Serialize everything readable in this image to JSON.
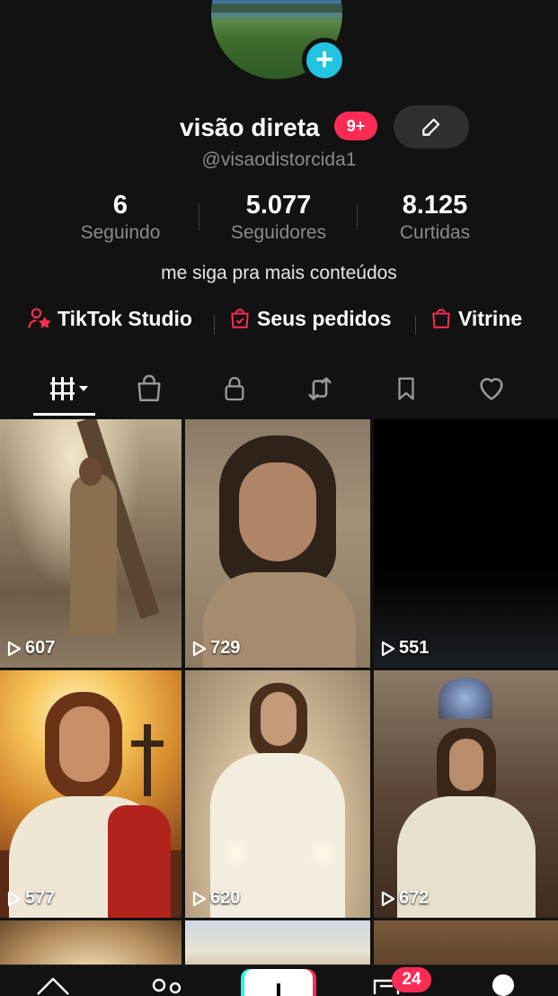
{
  "profile": {
    "name": "visão direta",
    "notif_badge": "9+",
    "handle": "@visaodistorcida1",
    "bio": "me siga pra mais conteúdos"
  },
  "stats": [
    {
      "value": "6",
      "label": "Seguindo"
    },
    {
      "value": "5.077",
      "label": "Seguidores"
    },
    {
      "value": "8.125",
      "label": "Curtidas"
    }
  ],
  "links": [
    {
      "label": "TikTok Studio",
      "icon": "person-star-icon"
    },
    {
      "label": "Seus pedidos",
      "icon": "shopping-bag-check-icon"
    },
    {
      "label": "Vitrine",
      "icon": "shopping-bag-icon"
    }
  ],
  "tabs": [
    "videos-grid",
    "shop",
    "private",
    "reposts",
    "saved",
    "liked"
  ],
  "videos": [
    {
      "views": "607"
    },
    {
      "views": "729"
    },
    {
      "views": "551"
    },
    {
      "views": "577"
    },
    {
      "views": "620"
    },
    {
      "views": "672"
    }
  ],
  "nav": {
    "inbox_badge": "24"
  },
  "colors": {
    "background": "#121212",
    "accent": "#fe2c55",
    "add_button": "#20c4e0"
  }
}
